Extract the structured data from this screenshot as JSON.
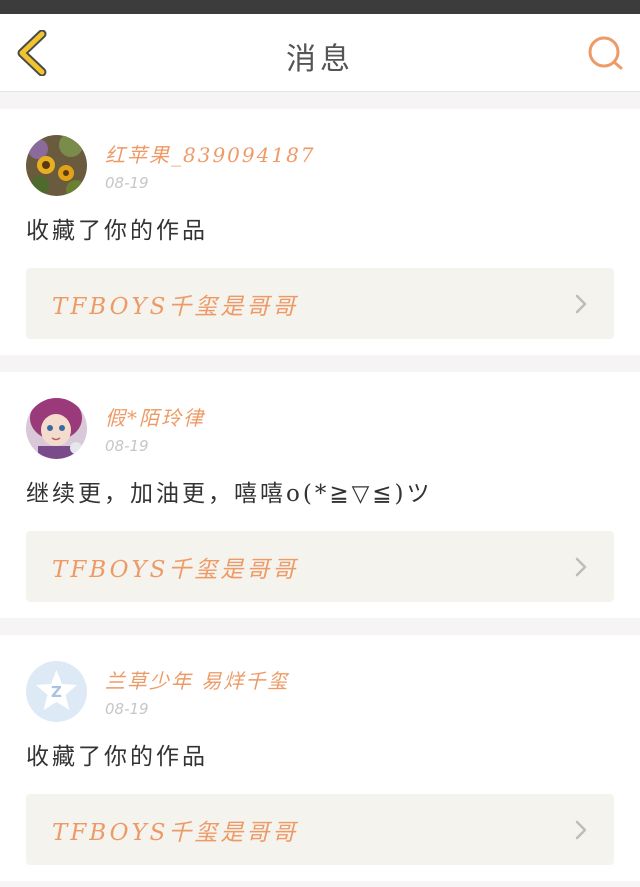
{
  "header": {
    "title": "消息"
  },
  "notifications": [
    {
      "username": "红苹果_839094187",
      "date": "08-19",
      "message": "收藏了你的作品",
      "work_title": "TFBOYS千玺是哥哥",
      "avatar": "sunflower-avatar"
    },
    {
      "username": "假*陌玲律",
      "date": "08-19",
      "message": "继续更，加油更，嘻嘻o(*≧▽≦)ツ",
      "work_title": "TFBOYS千玺是哥哥",
      "avatar": "anime-girl-avatar"
    },
    {
      "username": "兰草少年 易烊千玺",
      "date": "08-19",
      "message": "收藏了你的作品",
      "work_title": "TFBOYS千玺是哥哥",
      "avatar": "default-z-avatar"
    }
  ],
  "colors": {
    "accent": "#ee9a66",
    "back_arrow": "#f2c42c",
    "card_link_bg": "#f4f3ee",
    "page_bg": "#f6f4f4"
  }
}
